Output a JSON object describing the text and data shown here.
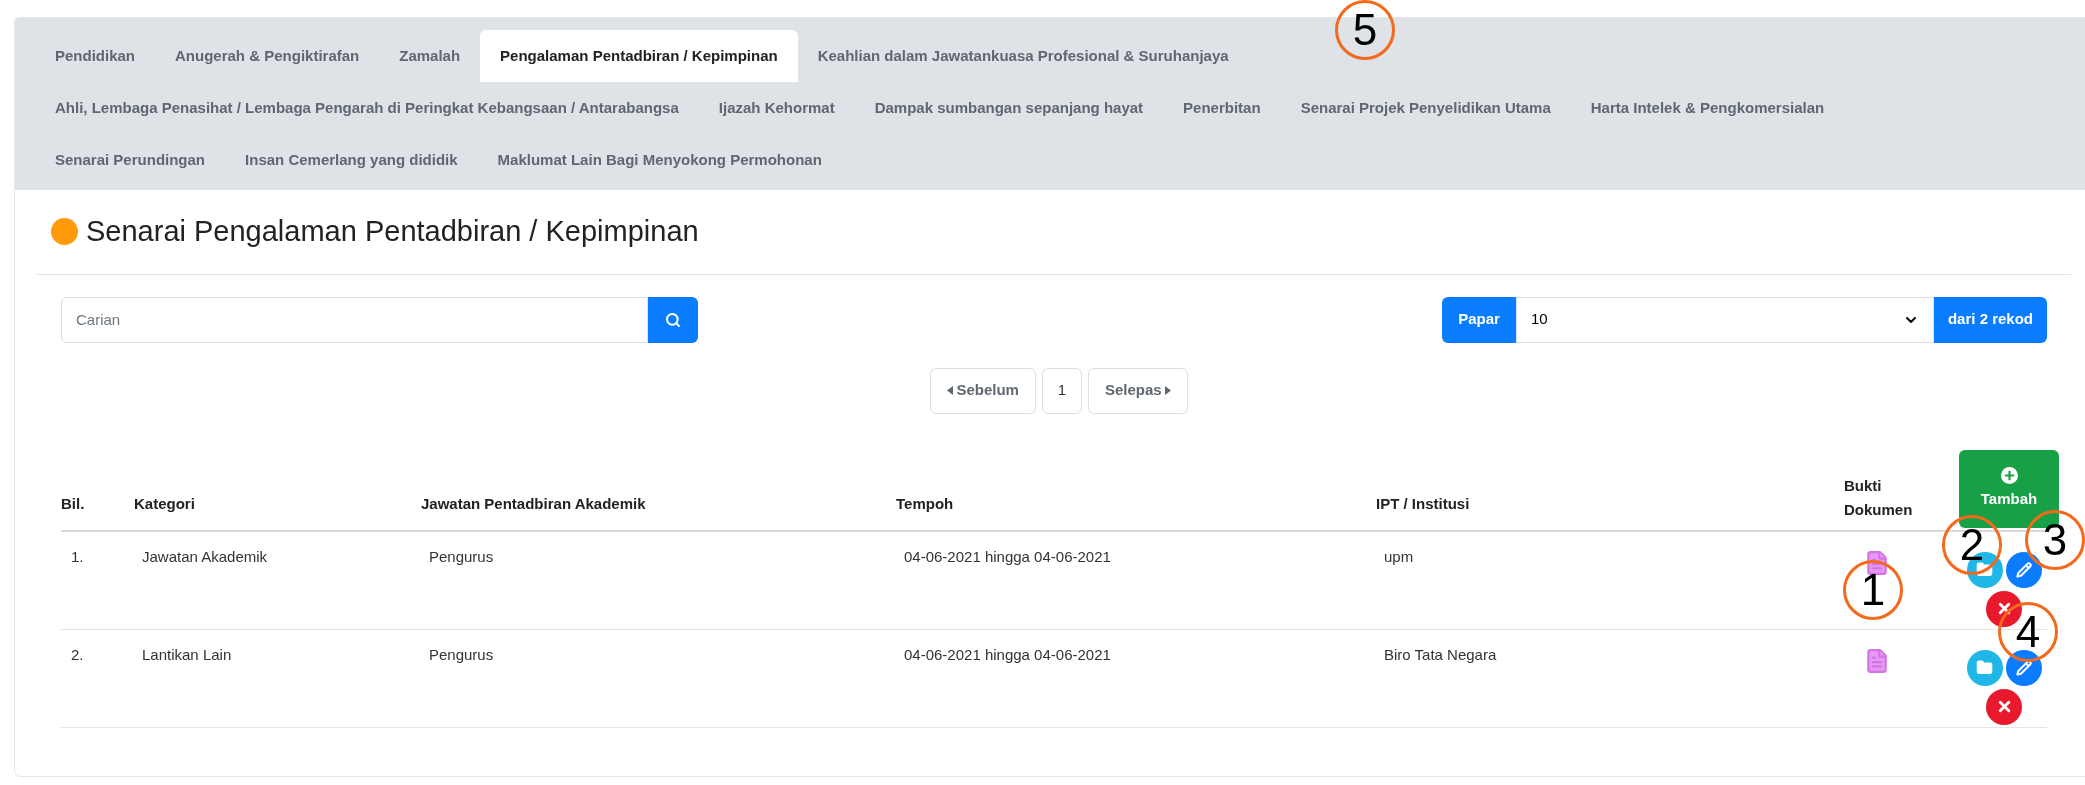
{
  "tabs": [
    {
      "label": "Pendidikan",
      "selected": false
    },
    {
      "label": "Anugerah & Pengiktirafan",
      "selected": false
    },
    {
      "label": "Zamalah",
      "selected": false
    },
    {
      "label": "Pengalaman Pentadbiran / Kepimpinan",
      "selected": true
    },
    {
      "label": "Keahlian dalam Jawatankuasa Profesional & Suruhanjaya",
      "selected": false
    },
    {
      "label": "Ahli, Lembaga Penasihat / Lembaga Pengarah di Peringkat Kebangsaan / Antarabangsa",
      "selected": false
    },
    {
      "label": "Ijazah Kehormat",
      "selected": false
    },
    {
      "label": "Dampak sumbangan sepanjang hayat",
      "selected": false
    },
    {
      "label": "Penerbitan",
      "selected": false
    },
    {
      "label": "Senarai Projek Penyelidikan Utama",
      "selected": false
    },
    {
      "label": "Harta Intelek & Pengkomersialan",
      "selected": false
    },
    {
      "label": "Senarai Perundingan",
      "selected": false
    },
    {
      "label": "Insan Cemerlang yang dididik",
      "selected": false
    },
    {
      "label": "Maklumat Lain Bagi Menyokong Permohonan",
      "selected": false
    }
  ],
  "page_title": "Senarai Pengalaman Pentadbiran / Kepimpinan",
  "search": {
    "placeholder": "Carian"
  },
  "page_size": {
    "label": "Papar",
    "value": "10",
    "suffix": "dari 2 rekod"
  },
  "pagination": {
    "previous": "Sebelum",
    "page": "1",
    "next": "Selepas"
  },
  "table": {
    "columns": [
      "Bil.",
      "Kategori",
      "Jawatan Pentadbiran Akademik",
      "Tempoh",
      "IPT / Institusi",
      "Bukti Dokumen"
    ],
    "add_button": "Tambah",
    "rows": [
      {
        "cells": [
          "1.",
          "Jawatan Akademik",
          "Pengurus",
          "04-06-2021 hingga 04-06-2021",
          "upm"
        ]
      },
      {
        "cells": [
          "2.",
          "Lantikan Lain",
          "Pengurus",
          "04-06-2021 hingga 04-06-2021",
          "Biro Tata Negara"
        ]
      }
    ]
  },
  "annotations": [
    {
      "label": "5"
    },
    {
      "label": "2"
    },
    {
      "label": "3"
    },
    {
      "label": "1"
    },
    {
      "label": "4"
    }
  ]
}
